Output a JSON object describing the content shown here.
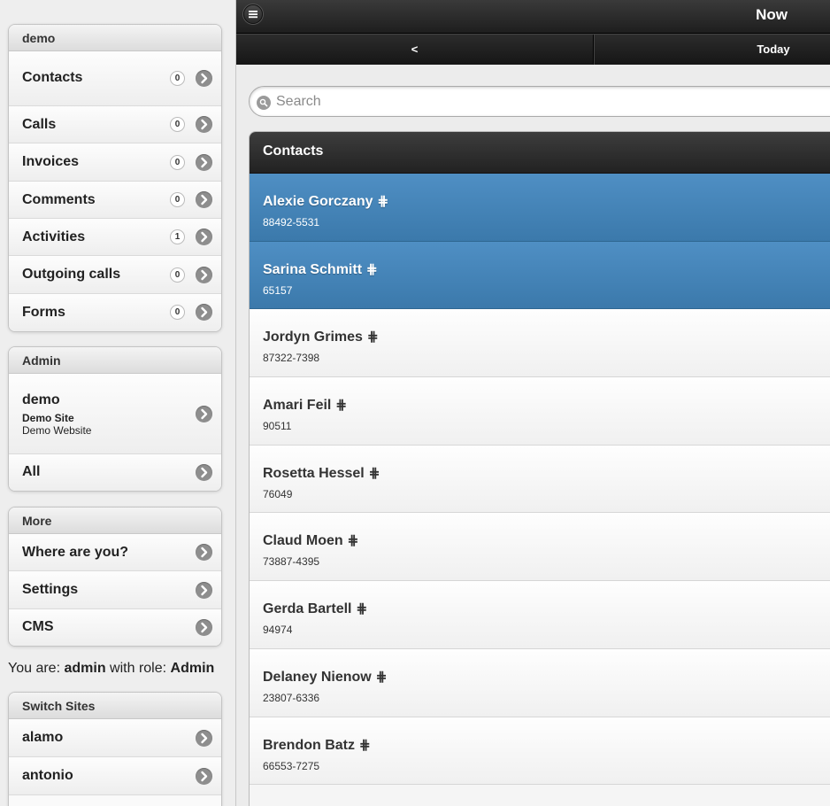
{
  "sidebar": {
    "main_group": {
      "title": "demo",
      "items": [
        {
          "label": "Contacts",
          "count": "0"
        },
        {
          "label": "Calls",
          "count": "0"
        },
        {
          "label": "Invoices",
          "count": "0"
        },
        {
          "label": "Comments",
          "count": "0"
        },
        {
          "label": "Activities",
          "count": "1"
        },
        {
          "label": "Outgoing calls",
          "count": "0"
        },
        {
          "label": "Forms",
          "count": "0"
        }
      ]
    },
    "admin_group": {
      "title": "Admin",
      "site_name": "demo",
      "site_title": "Demo Site",
      "site_subtitle": "Demo Website",
      "all_label": "All"
    },
    "more_group": {
      "title": "More",
      "items": [
        "Where are you?",
        "Settings",
        "CMS"
      ]
    },
    "role_line": {
      "prefix": "You are: ",
      "user": "admin",
      "middle": " with role: ",
      "role": "Admin"
    },
    "switch_group": {
      "title": "Switch Sites",
      "items": [
        "alamo",
        "antonio"
      ]
    }
  },
  "main": {
    "title": "Now",
    "nav_prev": "<",
    "nav_today": "Today",
    "search": {
      "placeholder": "Search",
      "value": ""
    },
    "list_title": "Contacts",
    "contacts": [
      {
        "name": "Alexie Gorczany",
        "phone": "88492-5531",
        "selected": true
      },
      {
        "name": "Sarina Schmitt",
        "phone": "65157",
        "selected": true
      },
      {
        "name": "Jordyn Grimes",
        "phone": "87322-7398",
        "selected": false
      },
      {
        "name": "Amari Feil",
        "phone": "90511",
        "selected": false
      },
      {
        "name": "Rosetta Hessel",
        "phone": "76049",
        "selected": false
      },
      {
        "name": "Claud Moen",
        "phone": "73887-4395",
        "selected": false
      },
      {
        "name": "Gerda Bartell",
        "phone": "94974",
        "selected": false
      },
      {
        "name": "Delaney Nienow",
        "phone": "23807-6336",
        "selected": false
      },
      {
        "name": "Brendon Batz",
        "phone": "66553-7275",
        "selected": false
      }
    ],
    "hash_glyph": "⋕"
  },
  "colors": {
    "selected_row": "#4583b8",
    "header_dark": "#2a2a2a",
    "arrow_icon": "#8e8e8e"
  }
}
